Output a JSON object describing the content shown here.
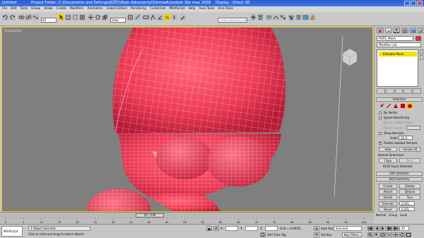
{
  "window": {
    "title_file": "Untitled",
    "title_folder": "Project Folder: C:\\Documents and Settings\\JOŽO\\Moje dokumenty\\3dsmax",
    "title_app": "Autodesk 3ds max 2009",
    "title_display": "Display : Direct 3D"
  },
  "menu": [
    "File",
    "Edit",
    "Tools",
    "Group",
    "Views",
    "Create",
    "Modifiers",
    "Animation",
    "Graph Editors",
    "Rendering",
    "Customize",
    "MAXScript",
    "Help",
    "Aura Tools",
    "Acre Tools"
  ],
  "toolbar": {
    "filter_value": "All",
    "view_value": "View",
    "selection_set_placeholder": "Create Selection Set"
  },
  "viewport": {
    "label": "Perspective",
    "border_color": "#e8c000",
    "mesh_color": "#ee3b55"
  },
  "command_panel": {
    "object_name": "POFE_Mesh",
    "modifier_list": "Modifier List",
    "stack_item": "Editable Mesh",
    "selection_rollout": "Selection",
    "by_vertex": "By Vertex",
    "ignore_backfacing": "Ignore Backfacing",
    "ignore_visible_edges": "Ignore Visible Edges",
    "planar_thresh": "Planar Thresh",
    "show_normals": "Show Normals",
    "scale_label": "Scale",
    "scale_value": "20.0",
    "delete_isolated": "Delete Isolated Vertices",
    "hide": "Hide",
    "unhide_all": "Unhide All",
    "named_selections": "Named Selections:",
    "copy": "Copy",
    "paste": "Paste",
    "faces_selected": "9185 Faces Selected",
    "soft_selection": "Soft Selection",
    "edit_geometry": "Edit Geometry",
    "create": "Create",
    "delete": "Delete",
    "attach": "Attach",
    "detach": "Detach",
    "divide": "Divide",
    "turn": "Turn",
    "extrude": "Extrude",
    "extrude_value": "0.0FL",
    "bevel": "Bevel",
    "bevel_value": "0.0FL",
    "normal": "Normal",
    "group": "Group",
    "local": "Local"
  },
  "timeline": {
    "thumb": "45 / 100",
    "ticks": [
      "0",
      "5",
      "10",
      "15",
      "20",
      "25",
      "30",
      "35",
      "40",
      "45",
      "50",
      "55",
      "60",
      "65",
      "70",
      "75",
      "80",
      "85",
      "90",
      "95",
      "100"
    ]
  },
  "status": {
    "maxscript": "MAXScript",
    "objects_selected": "1 Object Selected",
    "prompt": "Click or click-and-drag to select objects",
    "x_label": "X:",
    "y_label": "Y:",
    "z_label": "Z:",
    "grid": "Grid = 0.001FL",
    "add_time_tag": "Add Time Tag",
    "auto_key": "Auto Key",
    "selected": "Selected",
    "set_key": "Set Key",
    "key_filters": "Key Filters...",
    "frame": "45"
  }
}
